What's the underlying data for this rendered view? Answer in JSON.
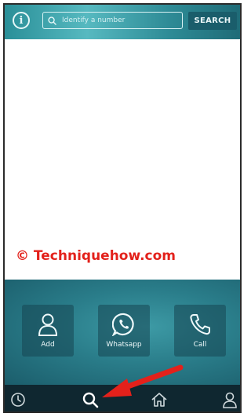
{
  "header": {
    "info_icon": "info-icon",
    "search_placeholder": "Identify a number",
    "search_value": "",
    "search_button_label": "SEARCH"
  },
  "watermark": "© Techniquehow.com",
  "actions": [
    {
      "label": "Add",
      "icon": "person-icon"
    },
    {
      "label": "Whatsapp",
      "icon": "whatsapp-icon"
    },
    {
      "label": "Call",
      "icon": "phone-icon"
    }
  ],
  "bottom_nav": [
    {
      "icon": "clock-icon"
    },
    {
      "icon": "search-icon",
      "active": true
    },
    {
      "icon": "home-icon"
    },
    {
      "icon": "profile-icon"
    }
  ],
  "colors": {
    "header_teal": "#3aa3ac",
    "search_button": "#1a5d6b",
    "bottom_nav": "#0f2730",
    "watermark": "#e3211b",
    "annotation_arrow": "#e3211b"
  }
}
